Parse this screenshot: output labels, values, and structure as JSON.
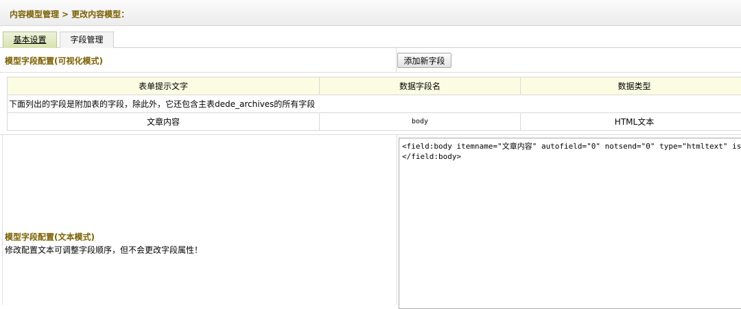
{
  "breadcrumb": {
    "parent": "内容模型管理",
    "separator": ">",
    "current": "更改内容模型："
  },
  "tabs": [
    {
      "label": "基本设置",
      "active": true
    },
    {
      "label": "字段管理",
      "active": false
    }
  ],
  "visual_config": {
    "title": "模型字段配置(可视化模式)",
    "add_button_label": "添加新字段"
  },
  "fields_table": {
    "headers": [
      "表单提示文字",
      "数据字段名",
      "数据类型"
    ],
    "note": "下面列出的字段是附加表的字段，除此外，它还包含主表dede_archives的所有字段",
    "rows": [
      {
        "label": "文章内容",
        "field": "body",
        "type": "HTML文本"
      }
    ]
  },
  "text_config": {
    "title": "模型字段配置(文本模式)",
    "hint": "修改配置文本可调整字段顺序，但不会更改字段属性！",
    "editor_value": "<field:body itemname=\"文章内容\" autofield=\"0\" notsend=\"0\" type=\"htmltext\" isnull=\"true\"\n</field:body>"
  },
  "colors": {
    "label_text": "#7a6000",
    "active_tab": "#d6e3ad",
    "table_header_bg": "#fbfce2"
  }
}
